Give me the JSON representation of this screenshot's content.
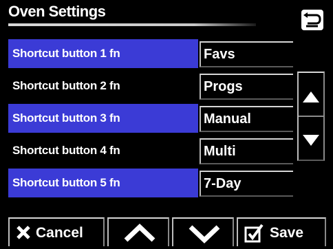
{
  "header": {
    "title": "Oven Settings",
    "back_icon": "return-arrow-icon"
  },
  "rows": [
    {
      "label": "Shortcut button 1 fn",
      "value": "Favs"
    },
    {
      "label": "Shortcut button 2 fn",
      "value": "Progs"
    },
    {
      "label": "Shortcut button 3 fn",
      "value": "Manual"
    },
    {
      "label": "Shortcut button 4 fn",
      "value": "Multi"
    },
    {
      "label": "Shortcut button 5 fn",
      "value": "7-Day"
    }
  ],
  "scrollbar": {
    "up_icon": "triangle-up-icon",
    "down_icon": "triangle-down-icon"
  },
  "footer": {
    "cancel_label": "Cancel",
    "cancel_icon": "x-icon",
    "up_icon": "chevron-up-icon",
    "down_icon": "chevron-down-icon",
    "save_label": "Save",
    "save_icon": "checkbox-check-icon"
  },
  "colors": {
    "highlight": "#3b3bd6",
    "background": "#000000",
    "text": "#ffffff"
  }
}
